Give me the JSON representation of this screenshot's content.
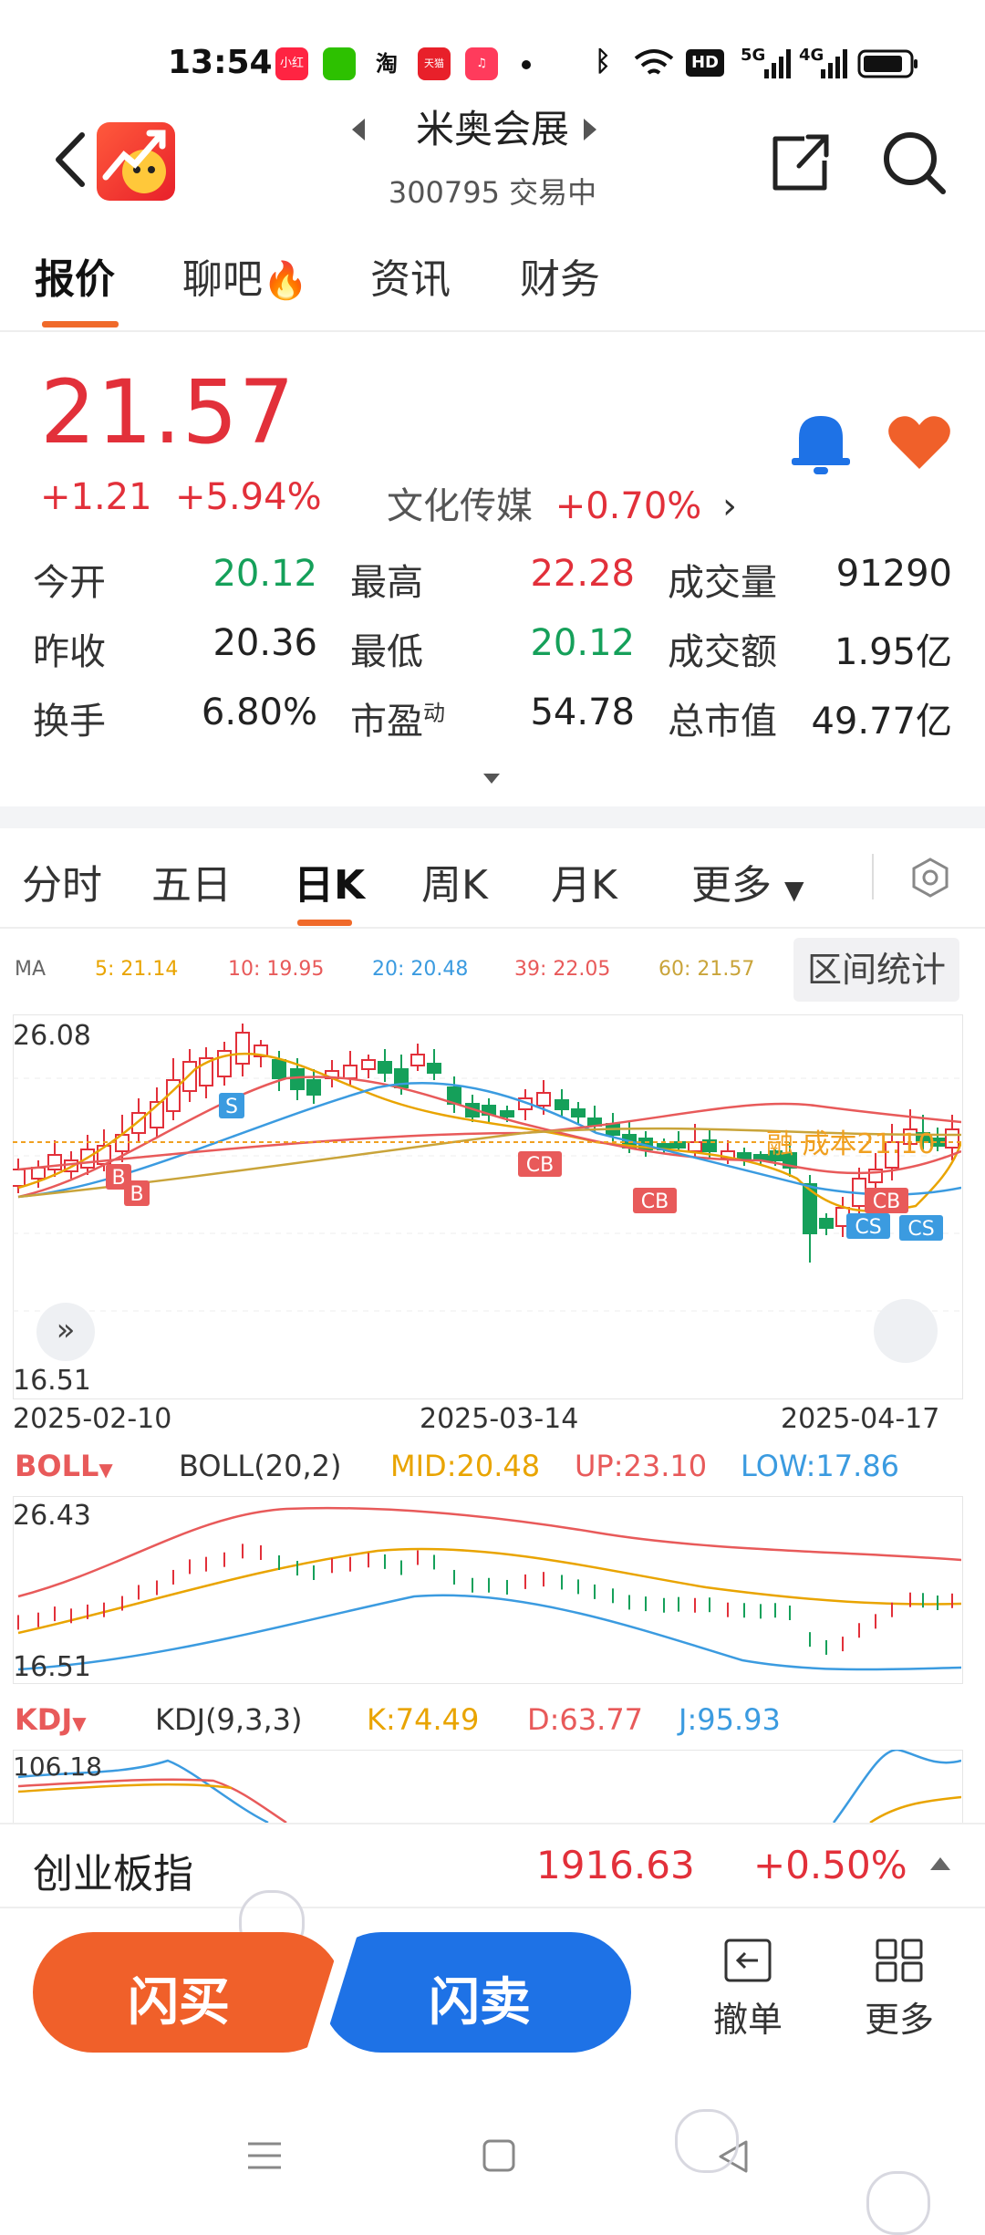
{
  "status_bar": {
    "time": "13:54",
    "apps": [
      "小红书",
      "微信",
      "淘",
      "天猫",
      "音乐"
    ],
    "network_labels": [
      "HD",
      "5G",
      "4G"
    ]
  },
  "header": {
    "title": "米奥会展",
    "code_status": "300795 交易中"
  },
  "tabs": [
    "报价",
    "聊吧",
    "资讯",
    "财务"
  ],
  "quote": {
    "price": "21.57",
    "change": "+1.21",
    "change_pct": "+5.94%",
    "sector_name": "文化传媒",
    "sector_pct": "+0.70%",
    "rows": [
      [
        {
          "label": "今开",
          "value": "20.12"
        },
        {
          "label": "最高",
          "value": "22.28"
        },
        {
          "label": "成交量",
          "value": "91290"
        }
      ],
      [
        {
          "label": "昨收",
          "value": "20.36"
        },
        {
          "label": "最低",
          "value": "20.12"
        },
        {
          "label": "成交额",
          "value": "1.95亿"
        }
      ],
      [
        {
          "label": "换手",
          "value": "6.80%"
        },
        {
          "label": "市盈",
          "label_sup": "动",
          "value": "54.78"
        },
        {
          "label": "总市值",
          "value": "49.77亿"
        }
      ]
    ]
  },
  "chart_tabs": [
    "分时",
    "五日",
    "日K",
    "周K",
    "月K",
    "更多"
  ],
  "ma": {
    "label": "MA",
    "items": [
      {
        "text": "5: 21.14",
        "color": "#e9a400"
      },
      {
        "text": "10: 19.95",
        "color": "#e85a5a"
      },
      {
        "text": "20: 20.48",
        "color": "#3b9be0"
      },
      {
        "text": "39: 22.05",
        "color": "#e85a5a"
      },
      {
        "text": "60: 21.57",
        "color": "#c9a43a"
      }
    ],
    "range_button": "区间统计"
  },
  "kline": {
    "y_max": "26.08",
    "y_min": "16.51",
    "dates": [
      "2025-02-10",
      "2025-03-14",
      "2025-04-17"
    ],
    "markers": [
      "B",
      "B",
      "S",
      "CB",
      "CB",
      "CB",
      "CS",
      "CS"
    ],
    "cost_label": "融 成本21.10"
  },
  "boll": {
    "name": "BOLL",
    "params": "BOLL(20,2)",
    "mid": "MID:20.48",
    "up": "UP:23.10",
    "low": "LOW:17.86",
    "y_max": "26.43",
    "y_min": "16.51"
  },
  "kdj": {
    "name": "KDJ",
    "params": "KDJ(9,3,3)",
    "k": "K:74.49",
    "d": "D:63.77",
    "j": "J:95.93",
    "y_max": "106.18"
  },
  "index_bar": {
    "name": "创业板指",
    "value": "1916.63",
    "pct": "+0.50%"
  },
  "actions": {
    "buy": "闪买",
    "sell": "闪卖",
    "cancel": "撤单",
    "more": "更多"
  },
  "colors": {
    "up": "#e2303a",
    "down": "#15a05a",
    "accent": "#f06a2a",
    "blue": "#1e72e6"
  }
}
